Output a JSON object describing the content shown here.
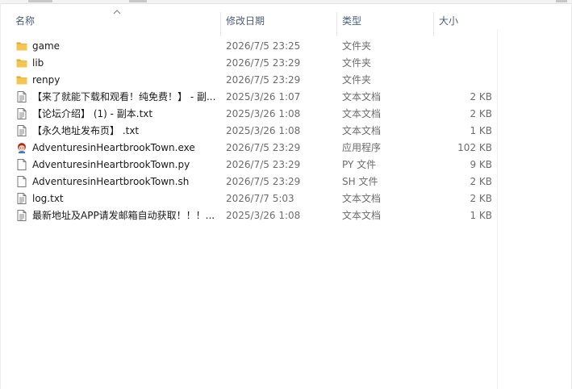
{
  "columns": {
    "name": "名称",
    "modified": "修改日期",
    "type": "类型",
    "size": "大小"
  },
  "files": [
    {
      "name": "game",
      "modified": "2026/7/5 23:25",
      "type": "文件夹",
      "size": "",
      "icon": "folder-icon"
    },
    {
      "name": "lib",
      "modified": "2026/7/5 23:29",
      "type": "文件夹",
      "size": "",
      "icon": "folder-icon"
    },
    {
      "name": "renpy",
      "modified": "2026/7/5 23:29",
      "type": "文件夹",
      "size": "",
      "icon": "folder-icon"
    },
    {
      "name": "【来了就能下载和观看！纯免费！】 - 副...",
      "modified": "2025/3/26 1:07",
      "type": "文本文档",
      "size": "2 KB",
      "icon": "text-document-icon"
    },
    {
      "name": "【论坛介绍】 (1) - 副本.txt",
      "modified": "2025/3/26 1:08",
      "type": "文本文档",
      "size": "2 KB",
      "icon": "text-document-icon"
    },
    {
      "name": "【永久地址发布页】 .txt",
      "modified": "2025/3/26 1:08",
      "type": "文本文档",
      "size": "1 KB",
      "icon": "text-document-icon"
    },
    {
      "name": "AdventuresinHeartbrookTown.exe",
      "modified": "2026/7/5 23:29",
      "type": "应用程序",
      "size": "102 KB",
      "icon": "app-exe-icon"
    },
    {
      "name": "AdventuresinHeartbrookTown.py",
      "modified": "2026/7/5 23:29",
      "type": "PY 文件",
      "size": "9 KB",
      "icon": "blank-file-icon"
    },
    {
      "name": "AdventuresinHeartbrookTown.sh",
      "modified": "2026/7/5 23:29",
      "type": "SH 文件",
      "size": "2 KB",
      "icon": "blank-file-icon"
    },
    {
      "name": "log.txt",
      "modified": "2026/7/7 5:03",
      "type": "文本文档",
      "size": "2 KB",
      "icon": "text-document-icon"
    },
    {
      "name": "最新地址及APP请发邮箱自动获取！！！...",
      "modified": "2025/3/26 1:08",
      "type": "文本文档",
      "size": "1 KB",
      "icon": "text-document-icon"
    }
  ],
  "colors": {
    "header_text": "#4c607a",
    "folder": "#f4c553",
    "folder_dark": "#e0a92b"
  }
}
